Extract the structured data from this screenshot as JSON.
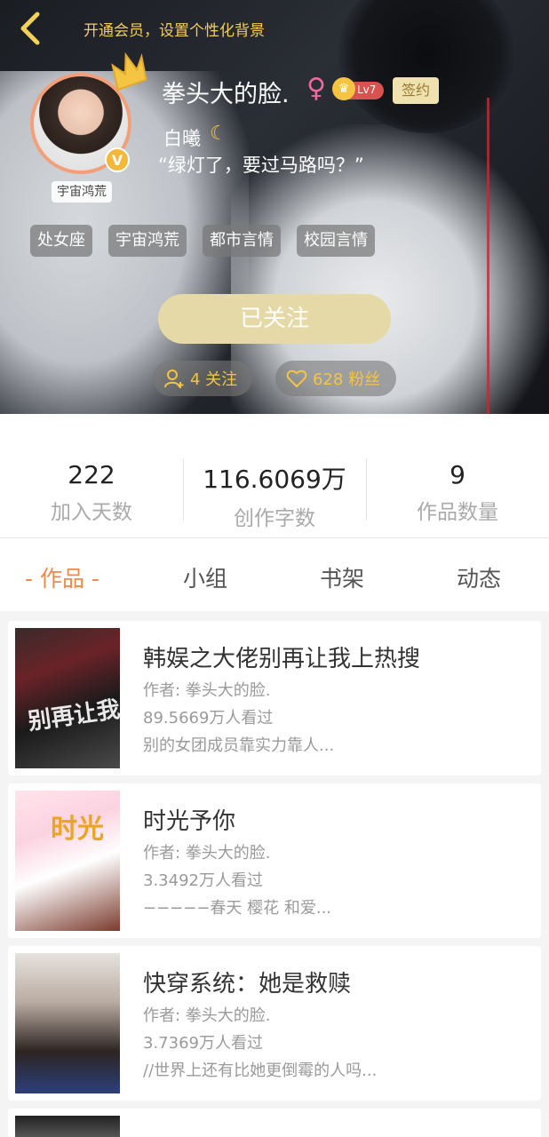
{
  "header": {
    "vip_text": "开通会员，设置个性化背景",
    "avatar_tag": "宇宙鸿荒",
    "v_badge": "V",
    "nickname": "拳头大的脸.",
    "gender_symbol": "♀",
    "level": "Lv7",
    "sign_label": "签约",
    "sub_name": "白曦",
    "motto": "“绿灯了，要过马路吗？”",
    "tags": [
      "处女座",
      "宇宙鸿荒",
      "都市言情",
      "校园言情"
    ],
    "follow_button": "已关注",
    "following_count": "4 关注",
    "fans_count": "628 粉丝"
  },
  "stats": [
    {
      "value": "222",
      "label": "加入天数"
    },
    {
      "value": "116.6069万",
      "label": "创作字数"
    },
    {
      "value": "9",
      "label": "作品数量"
    }
  ],
  "tabs": [
    "- 作品 -",
    "小组",
    "书架",
    "动态"
  ],
  "books": [
    {
      "title": "韩娱之大佬别再让我上热搜",
      "author": "作者: 拳头大的脸.",
      "views": "89.5669万人看过",
      "desc": "别的女团成员靠实力靠人..."
    },
    {
      "title": "时光予你",
      "author": "作者: 拳头大的脸.",
      "views": "3.3492万人看过",
      "desc": "−−−−−春天 樱花 和爱..."
    },
    {
      "title": "快穿系统：她是救赎",
      "author": "作者: 拳头大的脸.",
      "views": "3.7369万人看过",
      "desc": "//世界上还有比她更倒霉的人吗..."
    }
  ],
  "colors": {
    "accent": "#f08a4b",
    "gold": "#f4c542",
    "follow_bg": "#e6d9a8"
  }
}
